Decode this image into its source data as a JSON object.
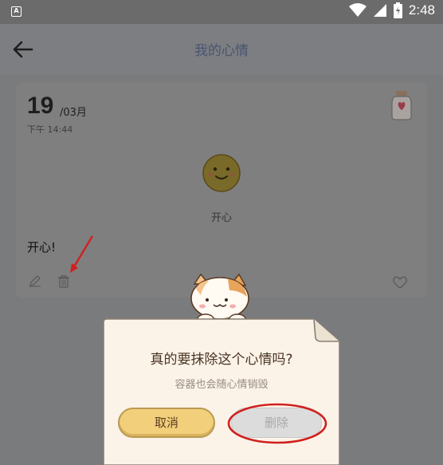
{
  "status_bar": {
    "app_badge": "A",
    "time": "2:48",
    "icons": [
      "wifi-icon",
      "signal-icon",
      "battery-icon"
    ]
  },
  "header": {
    "title": "我的心情",
    "back_icon": "arrow-left-icon"
  },
  "entry": {
    "day": "19",
    "month": "/03月",
    "time": "下午 14:44",
    "mood_label": "开心",
    "note": "开心!",
    "icons": [
      "jar-icon",
      "smile-face-icon",
      "edit-icon",
      "trash-icon",
      "heart-icon"
    ]
  },
  "dialog": {
    "title": "真的要抹除这个心情吗?",
    "subtitle": "容器也会随心情销毁",
    "cancel_label": "取消",
    "delete_label": "删除"
  },
  "colors": {
    "status_bar": "#6b6b6b",
    "header_bg": "#7c7e81",
    "title_color": "#4a5470",
    "card_bg": "#7f7f80",
    "dialog_bg": "#fbf3e8",
    "cancel_bg": "#f2cf7a",
    "delete_bg": "#dcdcdc",
    "annotation_red": "#d0201e"
  }
}
